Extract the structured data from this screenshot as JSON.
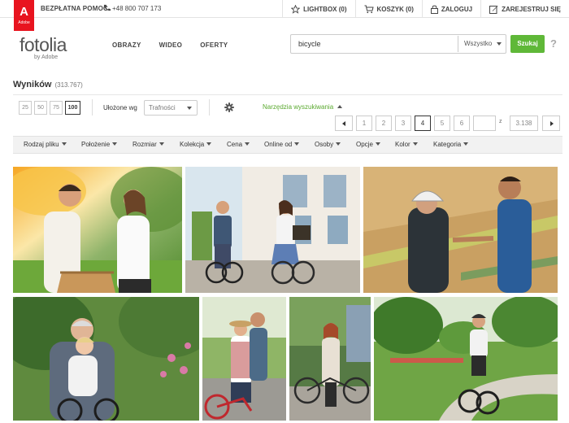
{
  "topbar": {
    "adobe_logo_text": "Adobe",
    "help_label": "BEZPŁATNA POMOC",
    "phone": "+48 800 707 173",
    "nav": [
      {
        "icon": "star-icon",
        "label": "LIGHTBOX (0)"
      },
      {
        "icon": "cart-icon",
        "label": "KOSZYK (0)"
      },
      {
        "icon": "lock-icon",
        "label": "ZALOGUJ"
      },
      {
        "icon": "edit-icon",
        "label": "ZAREJESTRUJ SIĘ"
      }
    ]
  },
  "header": {
    "brand": "fotolia",
    "brand_sub": "by Adobe",
    "nav": [
      "OBRAZY",
      "WIDEO",
      "OFERTY"
    ],
    "search": {
      "value": "bicycle",
      "scope": "Wszystko",
      "button": "Szukaj",
      "help": "?"
    }
  },
  "results": {
    "title": "Wyników",
    "count": "(313.767)",
    "sizes": [
      "25",
      "50",
      "75",
      "100"
    ],
    "active_size": "100",
    "sort_label": "Ułożone wg",
    "sort_value": "Trafności",
    "tools_label": "Narzędzia wyszukiwania"
  },
  "pagination": {
    "pages": [
      "1",
      "2",
      "3",
      "4",
      "5",
      "6"
    ],
    "current": "4",
    "of_label": "z",
    "total": "3.138"
  },
  "filters": [
    "Rodzaj pliku",
    "Położenie",
    "Rozmiar",
    "Kolekcja",
    "Cena",
    "Online od",
    "Osoby",
    "Opcje",
    "Kolor",
    "Kategoria"
  ],
  "colors": {
    "accent_green": "#5fb838",
    "adobe_red": "#e8141f",
    "link_green": "#5aa92f"
  }
}
